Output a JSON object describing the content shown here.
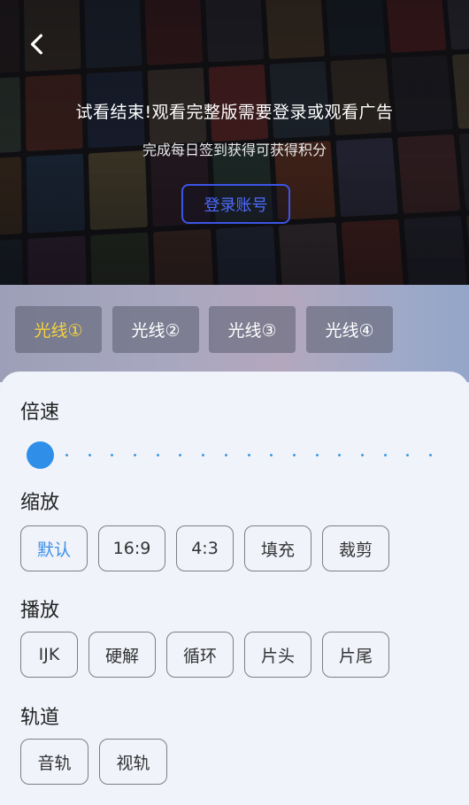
{
  "player": {
    "trial_message": "试看结束!观看完整版需要登录或观看广告",
    "checkin_message": "完成每日签到获得可获得积分",
    "login_button": "登录账号",
    "back_icon": "chevron-left-icon"
  },
  "lines": {
    "items": [
      {
        "label": "光线①",
        "active": true
      },
      {
        "label": "光线②",
        "active": false
      },
      {
        "label": "光线③",
        "active": false
      },
      {
        "label": "光线④",
        "active": false
      }
    ],
    "active_color": "#f5d33d"
  },
  "settings": {
    "speed": {
      "title": "倍速",
      "slider_level": 0
    },
    "zoom": {
      "title": "缩放",
      "options": [
        "默认",
        "16:9",
        "4:3",
        "填充",
        "裁剪"
      ],
      "selected": "默认"
    },
    "playback": {
      "title": "播放",
      "options": [
        "IJK",
        "硬解",
        "循环",
        "片头",
        "片尾"
      ]
    },
    "track": {
      "title": "轨道",
      "options": [
        "音轨",
        "视轨"
      ]
    }
  },
  "colors": {
    "accent": "#2f8fe8",
    "login_border": "#3b55e6"
  }
}
